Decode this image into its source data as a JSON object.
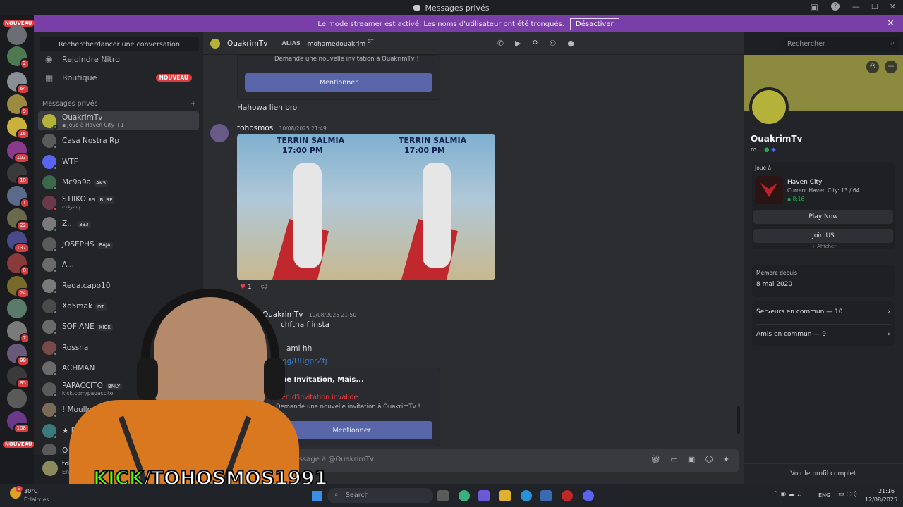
{
  "window": {
    "title": "Messages privés"
  },
  "banner": {
    "text": "Le mode streamer est activé. Les noms d'utilisateur ont été tronqués.",
    "button": "Désactiver"
  },
  "guilds": {
    "nouveau": "NOUVEAU",
    "badges": [
      "2",
      "64",
      "9",
      "16",
      "103",
      "18",
      "1",
      "22",
      "137",
      "8",
      "24",
      "7",
      "99",
      "85",
      "108"
    ]
  },
  "dm_column": {
    "search": "Rechercher/lancer une conversation",
    "nitro": "Rejoindre Nitro",
    "shop": "Boutique",
    "shop_badge": "NOUVEAU",
    "header": "Messages privés",
    "add": "+",
    "dms": [
      {
        "name": "OuakrimTv",
        "sub": "Joue à Haven City",
        "extra": "+1"
      },
      {
        "name": "Casa Nostra Rp"
      },
      {
        "name": "WTF"
      },
      {
        "name": "Mc9a9a",
        "tag": "AKS"
      },
      {
        "name": "STIIKO",
        "suffix": "RS",
        "tag": "BLRP",
        "sub": "ﭘﯿﺷﺮﻓﺖ"
      },
      {
        "name": "Z...",
        "tag": "333"
      },
      {
        "name": "JOSEPHS",
        "tag": "RAJA"
      },
      {
        "name": "A..."
      },
      {
        "name": "Reda.capo10"
      },
      {
        "name": "Xo5mak",
        "tag": "DT"
      },
      {
        "name": "SOFIANE",
        "tag": "KICK"
      },
      {
        "name": "Rossna"
      },
      {
        "name": "ACHMAN"
      },
      {
        "name": "PAPACCITO",
        "tag": "BNLY",
        "sub": "kick.com/papaccito"
      },
      {
        "name": "! Moullmhla"
      },
      {
        "name": "★ F"
      },
      {
        "name": "O"
      }
    ],
    "user": {
      "name": "tohosmos",
      "status": "En ligne"
    }
  },
  "chat": {
    "recipient": "OuakrimTv",
    "alias_label": "ALIAS",
    "alias": "mohamedouakrim",
    "alias_tag": "DT",
    "search_placeholder": "Rechercher",
    "invite_sub_top": "Demande une nouvelle invitation à OuakrimTv !",
    "mention": "Mentionner",
    "msg1": "Hahowa lien bro",
    "msg2_author": "tohosmos",
    "msg2_time": "10/08/2025 21:49",
    "image_title": "TERRIN SALMIA",
    "image_time": "17:00 PM",
    "reaction_count": "1",
    "msg3_author": "OuakrimTv",
    "msg3_time": "10/08/2025 21:50",
    "msg3_line1": "chftha f insta",
    "msg3_line2": "ami hh",
    "msg3_link": "gg/URgprZtj",
    "invite_title": "Une Invitation, Mais...",
    "invite_invalid": "Lien d'invitation invalide",
    "invite_sub": "Demande une nouvelle invitation à OuakrimTv !",
    "composer": "Envoyer un message à @OuakrimTv"
  },
  "profile": {
    "name": "OuakrimTv",
    "handle": "m...",
    "playing_label": "Joue à",
    "game": "Haven City",
    "game_detail": "Current Haven City: 13 / 64",
    "game_time": "8:16",
    "play_now": "Play Now",
    "join": "Join US",
    "more": "+ Afficher",
    "member_since_label": "Membre depuis",
    "member_since": "8 mai 2020",
    "servers": "Serveurs en commun — 10",
    "friends": "Amis en commun — 9",
    "full_profile": "Voir le profil complet"
  },
  "stream": {
    "overlay": "KICK/TOHOSMOS1991",
    "overlay_colors": {
      "kick": "#53fc18",
      "rest": "#ffffff"
    }
  },
  "taskbar": {
    "temp": "30°C",
    "weather": "Éclaircies",
    "weather_badge": "3",
    "search": "Search",
    "lang": "ENG",
    "time": "21:16",
    "date": "12/08/2025"
  }
}
